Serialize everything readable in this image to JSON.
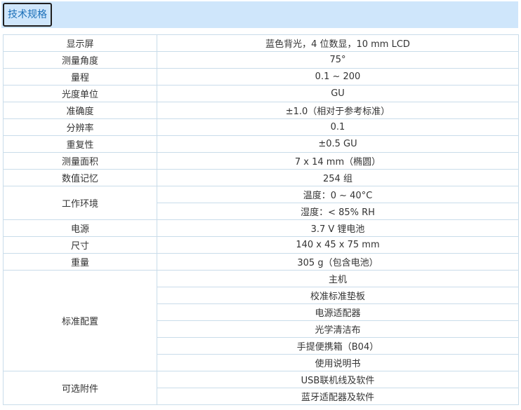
{
  "tab": {
    "label": "技术规格"
  },
  "specs": [
    {
      "name": "显示屏",
      "values": [
        "蓝色背光，4 位数显，10 mm LCD"
      ]
    },
    {
      "name": "测量角度",
      "values": [
        "75°"
      ]
    },
    {
      "name": "量程",
      "values": [
        "0.1 ~ 200"
      ]
    },
    {
      "name": "光度单位",
      "values": [
        "GU"
      ]
    },
    {
      "name": "准确度",
      "values": [
        "±1.0（相对于参考标准）"
      ]
    },
    {
      "name": "分辨率",
      "values": [
        "0.1"
      ]
    },
    {
      "name": "重复性",
      "values": [
        "±0.5 GU"
      ]
    },
    {
      "name": "测量面积",
      "values": [
        "7 x 14 mm（椭圆）"
      ]
    },
    {
      "name": "数值记忆",
      "values": [
        "254 组"
      ]
    },
    {
      "name": "工作环境",
      "values": [
        "温度：0 ~ 40°C",
        "湿度：< 85% RH"
      ]
    },
    {
      "name": "电源",
      "values": [
        "3.7 V 锂电池"
      ]
    },
    {
      "name": "尺寸",
      "values": [
        "140 x 45 x 75 mm"
      ]
    },
    {
      "name": "重量",
      "values": [
        "305 g（包含电池）"
      ]
    },
    {
      "name": "标准配置",
      "values": [
        "主机",
        "校准标准垫板",
        "电源适配器",
        "光学清洁布",
        "手提便携箱（B04）",
        "使用说明书"
      ]
    },
    {
      "name": "可选附件",
      "values": [
        "USB联机线及软件",
        "蓝牙适配器及软件"
      ]
    }
  ]
}
